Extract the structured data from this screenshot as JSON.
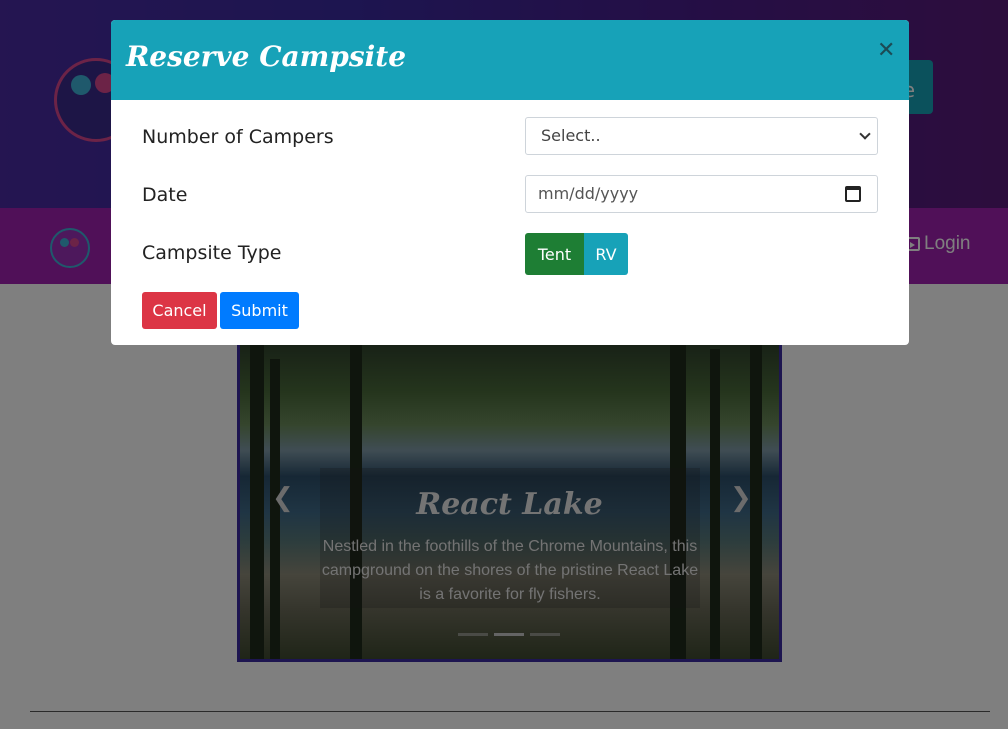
{
  "background": {
    "nav_login_label": "Login"
  },
  "carousel": {
    "title": "React Lake",
    "text": "Nestled in the foothills of the Chrome Mountains, this campground on the shores of the pristine React Lake is a favorite for fly fishers.",
    "prev_icon": "chevron-left-icon",
    "next_icon": "chevron-right-icon",
    "active_slide": 2,
    "slide_count": 3
  },
  "modal": {
    "title": "Reserve Campsite",
    "close_icon": "close-icon",
    "fields": {
      "campers_label": "Number of Campers",
      "campers_value": "Select..",
      "date_label": "Date",
      "date_placeholder": "mm/dd/yyyy",
      "type_label": "Campsite Type",
      "type_options": [
        "Tent",
        "RV"
      ],
      "type_selected": "Tent"
    },
    "cancel_label": "Cancel",
    "submit_label": "Submit"
  },
  "colors": {
    "header_teal": "#17a2b8",
    "tent_green": "#1e7e34",
    "cancel_red": "#dc3545",
    "submit_blue": "#007bff",
    "navbar_purple": "#a020b0",
    "jumbotron_indigo": "#3a2aa0"
  }
}
